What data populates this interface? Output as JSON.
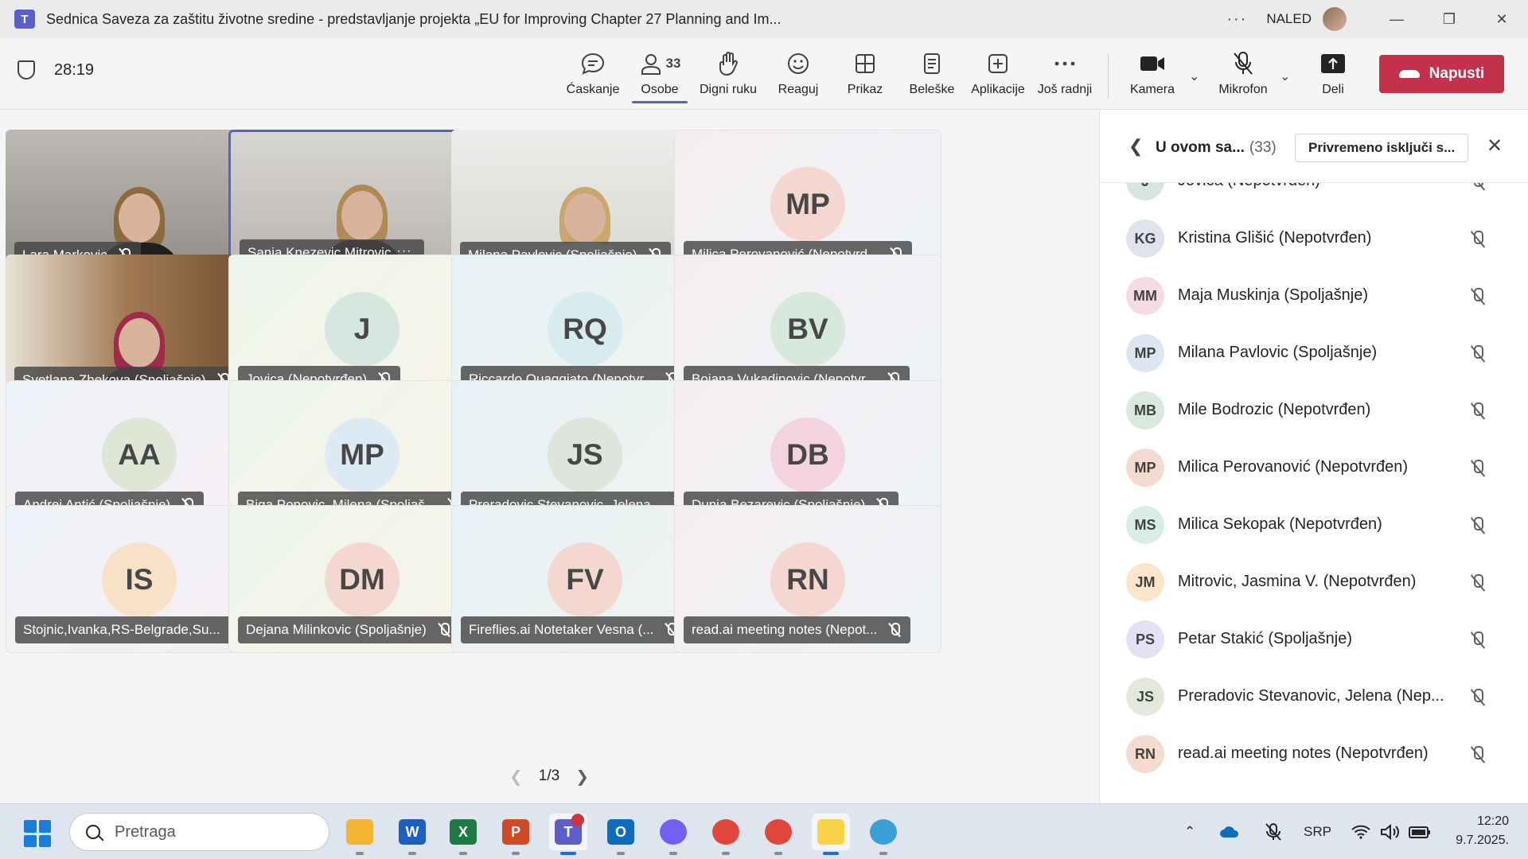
{
  "window": {
    "title": "Sednica Saveza za zaštitu životne sredine - predstavljanje projekta „EU for Improving Chapter 27 Planning and Im...",
    "org": "NALED"
  },
  "toolbar": {
    "timer": "28:19",
    "buttons": [
      {
        "id": "chat",
        "label": "Ćaskanje",
        "icon": "chat-icon"
      },
      {
        "id": "people",
        "label": "Osobe",
        "icon": "people-icon",
        "count": "33"
      },
      {
        "id": "raise",
        "label": "Digni ruku",
        "icon": "hand-icon"
      },
      {
        "id": "react",
        "label": "Reaguj",
        "icon": "smiley-icon"
      },
      {
        "id": "view",
        "label": "Prikaz",
        "icon": "grid-icon"
      },
      {
        "id": "notes",
        "label": "Beleške",
        "icon": "notes-icon"
      },
      {
        "id": "apps",
        "label": "Aplikacije",
        "icon": "plus-icon"
      },
      {
        "id": "more",
        "label": "Još radnji",
        "icon": "more-icon"
      },
      {
        "id": "camera",
        "label": "Kamera",
        "icon": "camera-icon"
      },
      {
        "id": "mic",
        "label": "Mikrofon",
        "icon": "mic-off-icon"
      },
      {
        "id": "share",
        "label": "Deli",
        "icon": "share-icon"
      }
    ],
    "leave_label": "Napusti"
  },
  "tiles": [
    {
      "name": "Lara Markovic",
      "type": "video",
      "more": false
    },
    {
      "name": "Sanja Knezevic Mitrovic",
      "type": "video",
      "more": true,
      "selected": true
    },
    {
      "name": "Milana Pavlovic (Spoljašnje)",
      "type": "video",
      "more": false
    },
    {
      "name": "Milica Perovanović (Nepotvrd...",
      "type": "avatar",
      "initials": "MP",
      "avatar_color": "#f4d8cf"
    },
    {
      "name": "Svetlana Zhekova (Spoljašnje)",
      "type": "video",
      "more": false
    },
    {
      "name": "Jovica (Nepotvrđen)",
      "type": "avatar",
      "initials": "J",
      "avatar_color": "#d6e7df"
    },
    {
      "name": "Riccardo Quaggiato (Nepotvr...",
      "type": "avatar",
      "initials": "RQ",
      "avatar_color": "#d8ecf0"
    },
    {
      "name": "Bojana Vukadinovic (Nepotvr...",
      "type": "avatar",
      "initials": "BV",
      "avatar_color": "#d7e8dc"
    },
    {
      "name": "Andrej Antić (Spoljašnje)",
      "type": "avatar",
      "initials": "AA",
      "avatar_color": "#dfe6d6"
    },
    {
      "name": "Biga Popovic, Milena (Spoljaš...",
      "type": "avatar",
      "initials": "MP",
      "avatar_color": "#dbeaf3"
    },
    {
      "name": "Preradovic Stevanovic, Jelena...",
      "type": "avatar",
      "initials": "JS",
      "avatar_color": "#dde5dc"
    },
    {
      "name": "Dunja Bezarevic (Spoljašnje)",
      "type": "avatar",
      "initials": "DB",
      "avatar_color": "#f2d3de"
    },
    {
      "name": "Stojnic,Ivanka,RS-Belgrade,Su...",
      "type": "avatar",
      "initials": "IS",
      "avatar_color": "#f7e2c8"
    },
    {
      "name": "Dejana Milinkovic (Spoljašnje)",
      "type": "avatar",
      "initials": "DM",
      "avatar_color": "#f4d8cf"
    },
    {
      "name": "Fireflies.ai Notetaker Vesna (...",
      "type": "avatar",
      "initials": "FV",
      "avatar_color": "#f4d8cf"
    },
    {
      "name": "read.ai meeting notes (Nepot...",
      "type": "avatar",
      "initials": "RN",
      "avatar_color": "#f4d8cf"
    }
  ],
  "pager": {
    "text": "1/3"
  },
  "panel": {
    "title": "U ovom sa...",
    "count": "(33)",
    "mute_button": "Privremeno isključi s...",
    "participants": [
      {
        "initials": "J",
        "name": "Jovica (Nepotvrđen)",
        "color": "#d6e7df"
      },
      {
        "initials": "KG",
        "name": "Kristina Glišić (Nepotvrđen)",
        "color": "#dfe3ec"
      },
      {
        "initials": "MM",
        "name": "Maja Muskinja (Spoljašnje)",
        "color": "#f6dbe3"
      },
      {
        "initials": "MP",
        "name": "Milana Pavlovic (Spoljašnje)",
        "color": "#dbe6f2"
      },
      {
        "initials": "MB",
        "name": "Mile Bodrozic (Nepotvrđen)",
        "color": "#d9e9de"
      },
      {
        "initials": "MP",
        "name": "Milica Perovanović (Nepotvrđen)",
        "color": "#f5dacf"
      },
      {
        "initials": "MS",
        "name": "Milica Sekopak (Nepotvrđen)",
        "color": "#d8eee4"
      },
      {
        "initials": "JM",
        "name": "Mitrovic, Jasmina V. (Nepotvrđen)",
        "color": "#fbe6cc"
      },
      {
        "initials": "PS",
        "name": "Petar Stakić (Spoljašnje)",
        "color": "#e3e2f4"
      },
      {
        "initials": "JS",
        "name": "Preradovic Stevanovic, Jelena (Nep...",
        "color": "#e2e8da"
      },
      {
        "initials": "RN",
        "name": "read.ai meeting notes (Nepotvrđen)",
        "color": "#f5dacf"
      }
    ]
  },
  "taskbar": {
    "search_placeholder": "Pretraga",
    "apps": [
      {
        "name": "file-explorer",
        "label": "",
        "color": "#f2b632"
      },
      {
        "name": "word",
        "label": "W",
        "color": "#1d5fbf"
      },
      {
        "name": "excel",
        "label": "X",
        "color": "#1e7a45"
      },
      {
        "name": "powerpoint",
        "label": "P",
        "color": "#cf4a26"
      },
      {
        "name": "teams",
        "label": "T",
        "color": "#5b5fc7"
      },
      {
        "name": "outlook",
        "label": "O",
        "color": "#0f6cbd"
      },
      {
        "name": "viber",
        "label": "",
        "color": "#7360f2"
      },
      {
        "name": "chrome-profile",
        "label": "",
        "color": "#e0463a"
      },
      {
        "name": "chrome",
        "label": "",
        "color": "#e0463a"
      },
      {
        "name": "sticky-notes",
        "label": "",
        "color": "#f5d547"
      },
      {
        "name": "paint",
        "label": "",
        "color": "#3aa0d8"
      }
    ],
    "lang": "SRP",
    "time": "12:20",
    "date": "9.7.2025."
  }
}
